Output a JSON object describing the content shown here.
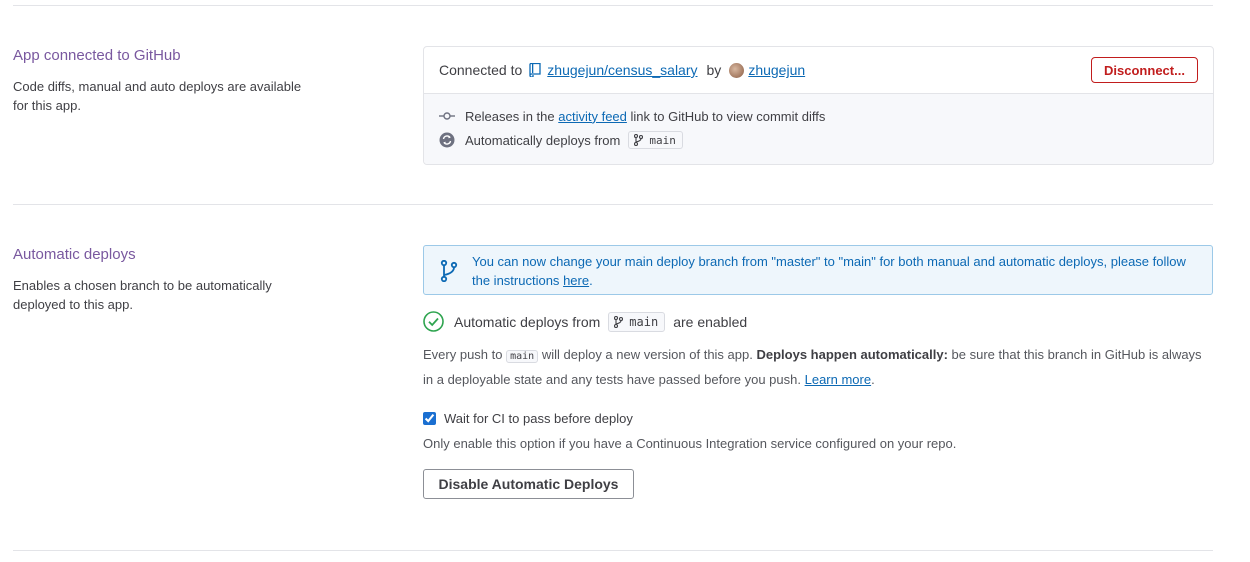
{
  "github_section": {
    "title": "App connected to GitHub",
    "description": "Code diffs, manual and auto deploys are available for this app.",
    "connected_label": "Connected to",
    "repo": "zhugejun/census_salary",
    "by_label": "by",
    "user": "zhugejun",
    "disconnect_button": "Disconnect...",
    "releases_prefix": "Releases in the",
    "releases_link": "activity feed",
    "releases_suffix": "link to GitHub to view commit diffs",
    "auto_deploy_label": "Automatically deploys from",
    "branch": "main"
  },
  "auto_deploys_section": {
    "title": "Automatic deploys",
    "description": "Enables a chosen branch to be automatically deployed to this app.",
    "info_text": "You can now change your main deploy branch from \"master\" to \"main\" for both manual and automatic deploys, please follow the instructions",
    "info_link": "here",
    "info_suffix": ".",
    "enabled_prefix": "Automatic deploys from",
    "enabled_branch": "main",
    "enabled_suffix": "are enabled",
    "push_prefix": "Every push to",
    "push_branch": "main",
    "push_middle": "will deploy a new version of this app.",
    "push_bold": "Deploys happen automatically:",
    "push_rest": "be sure that this branch in GitHub is always in a deployable state and any tests have passed before you push.",
    "learn_more": "Learn more",
    "learn_more_suffix": ".",
    "ci_checkbox_label": "Wait for CI to pass before deploy",
    "ci_checked": true,
    "ci_help": "Only enable this option if you have a Continuous Integration service configured on your repo.",
    "disable_button": "Disable Automatic Deploys"
  },
  "colors": {
    "section_title": "#79589f",
    "link": "#0c69b4",
    "danger": "#c11d1d",
    "success": "#2ea44f"
  }
}
